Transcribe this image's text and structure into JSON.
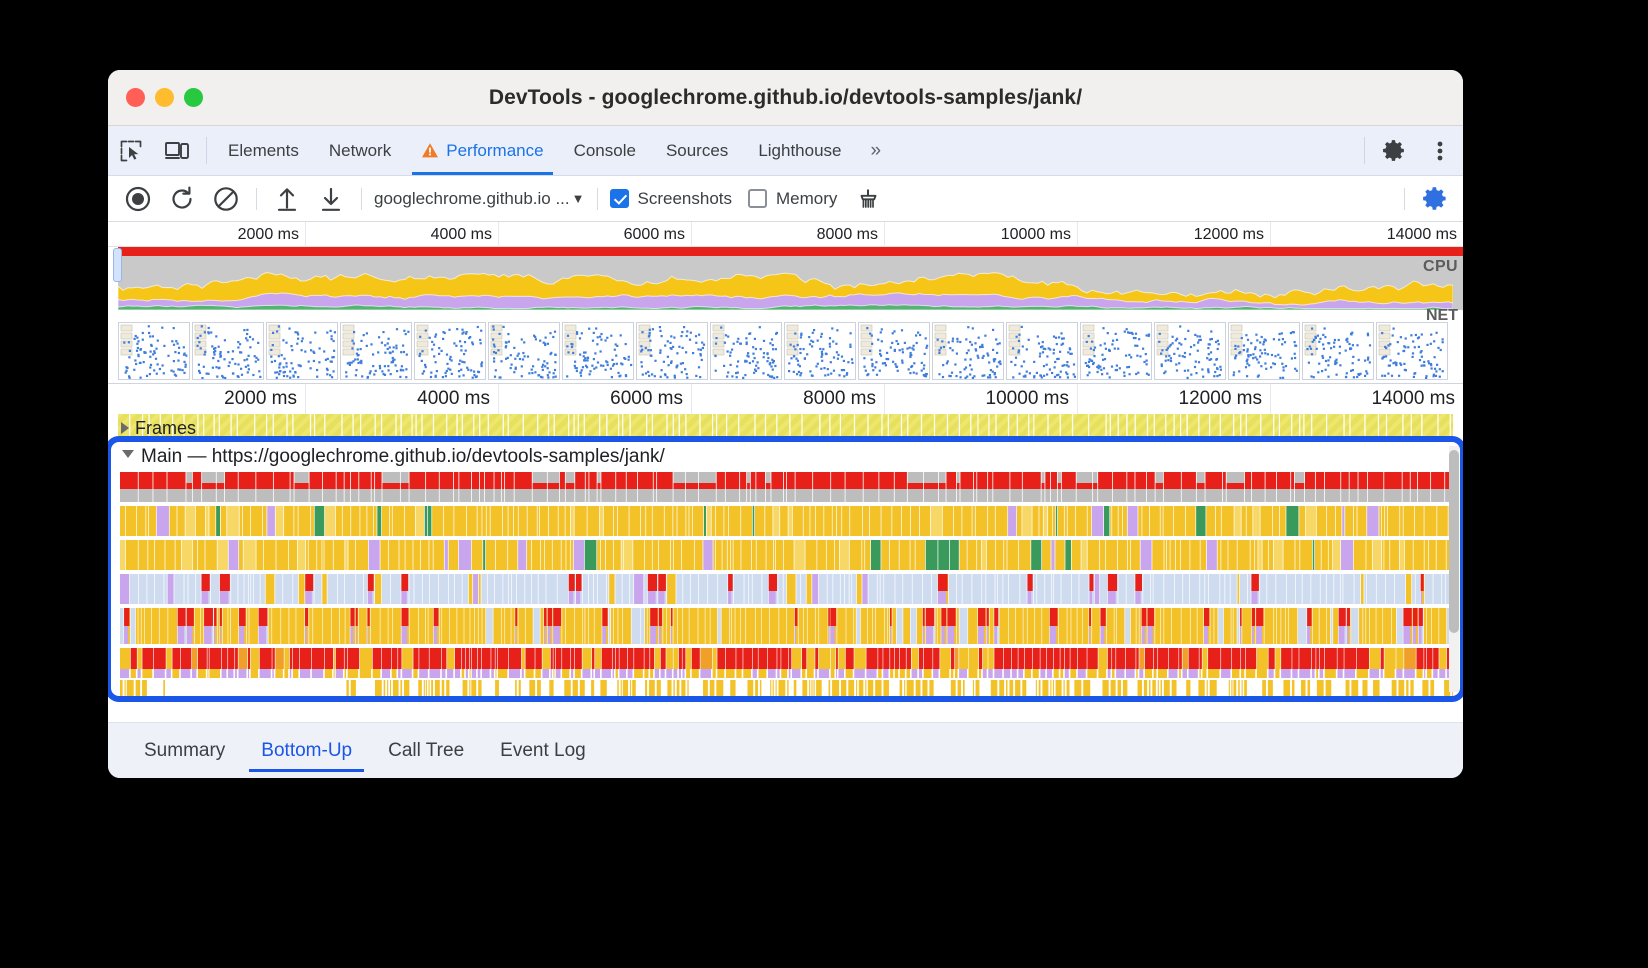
{
  "window": {
    "title": "DevTools - googlechrome.github.io/devtools-samples/jank/",
    "traffic": {
      "close": "close-button",
      "minimize": "minimize-button",
      "zoom": "zoom-button"
    }
  },
  "tabbar": {
    "inspect_icon": "inspect-element-icon",
    "device_icon": "device-toolbar-icon",
    "tabs": [
      {
        "label": "Elements",
        "active": false,
        "warning": false
      },
      {
        "label": "Network",
        "active": false,
        "warning": false
      },
      {
        "label": "Performance",
        "active": true,
        "warning": true
      },
      {
        "label": "Console",
        "active": false,
        "warning": false
      },
      {
        "label": "Sources",
        "active": false,
        "warning": false
      },
      {
        "label": "Lighthouse",
        "active": false,
        "warning": false
      }
    ],
    "more_tabs": "»",
    "settings_icon": "gear-icon",
    "menu_icon": "kebab-menu-icon"
  },
  "toolbar": {
    "record_icon": "record-button",
    "reload_record_icon": "reload-and-record-icon",
    "clear_icon": "clear-recording-icon",
    "load_icon": "load-profile-icon",
    "save_icon": "save-profile-icon",
    "url_select_value": "googlechrome.github.io ...",
    "screenshots_label": "Screenshots",
    "screenshots_checked": true,
    "memory_label": "Memory",
    "memory_checked": false,
    "garbage_icon": "collect-garbage-icon",
    "capture_settings_icon": "capture-settings-gear-icon"
  },
  "overview": {
    "ticks": [
      "2000 ms",
      "4000 ms",
      "6000 ms",
      "8000 ms",
      "10000 ms",
      "12000 ms",
      "14000 ms"
    ],
    "cpu_label": "CPU",
    "net_label": "NET",
    "colors": {
      "long_task_bar": "#e8201a",
      "cpu_idle": "#c9c9c9",
      "scripting": "#f5c518",
      "rendering": "#c8a5ec",
      "painting": "#56b472",
      "loading": "#8fb7e8"
    }
  },
  "timeline": {
    "ticks": [
      "2000 ms",
      "4000 ms",
      "6000 ms",
      "8000 ms",
      "10000 ms",
      "12000 ms",
      "14000 ms"
    ],
    "frames_label": "Frames",
    "frames_expanded": false,
    "main_label": "Main — https://googlechrome.github.io/devtools-samples/jank/",
    "main_expanded": true,
    "highlight_color": "#1a56e8"
  },
  "bottom_tabs": {
    "items": [
      {
        "label": "Summary",
        "active": false
      },
      {
        "label": "Bottom-Up",
        "active": true
      },
      {
        "label": "Call Tree",
        "active": false
      },
      {
        "label": "Event Log",
        "active": false
      }
    ]
  }
}
